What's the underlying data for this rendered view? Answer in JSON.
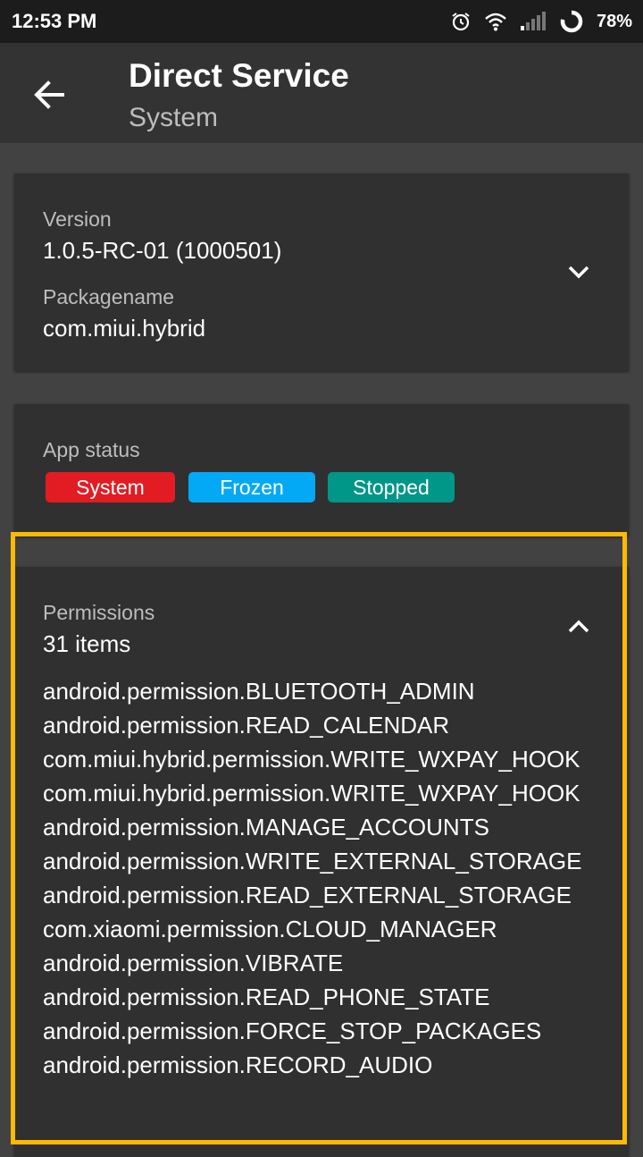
{
  "status_bar": {
    "time": "12:53 PM",
    "battery": "78%"
  },
  "toolbar": {
    "title": "Direct Service",
    "subtitle": "System"
  },
  "info_card": {
    "version_label": "Version",
    "version_value": "1.0.5-RC-01 (1000501)",
    "package_label": "Packagename",
    "package_value": "com.miui.hybrid"
  },
  "status_card": {
    "label": "App status",
    "badges": [
      {
        "text": "System",
        "color": "#e31b23"
      },
      {
        "text": "Frozen",
        "color": "#03a9f4"
      },
      {
        "text": "Stopped",
        "color": "#009688"
      }
    ]
  },
  "permissions": {
    "label": "Permissions",
    "count": "31 items",
    "items": [
      "android.permission.BLUETOOTH_ADMIN",
      "android.permission.READ_CALENDAR",
      "com.miui.hybrid.permission.WRITE_WXPAY_HOOK",
      "com.miui.hybrid.permission.WRITE_WXPAY_HOOK",
      "android.permission.MANAGE_ACCOUNTS",
      "android.permission.WRITE_EXTERNAL_STORAGE",
      "android.permission.READ_EXTERNAL_STORAGE",
      "com.xiaomi.permission.CLOUD_MANAGER",
      "android.permission.VIBRATE",
      "android.permission.READ_PHONE_STATE",
      "android.permission.FORCE_STOP_PACKAGES",
      "android.permission.RECORD_AUDIO"
    ]
  },
  "icons": {
    "back": "arrow-left-icon",
    "expand": "chevron-down-icon",
    "collapse": "chevron-up-icon",
    "alarm": "alarm-icon",
    "wifi": "wifi-icon",
    "signal": "signal-icon",
    "battery": "battery-ring-icon"
  }
}
